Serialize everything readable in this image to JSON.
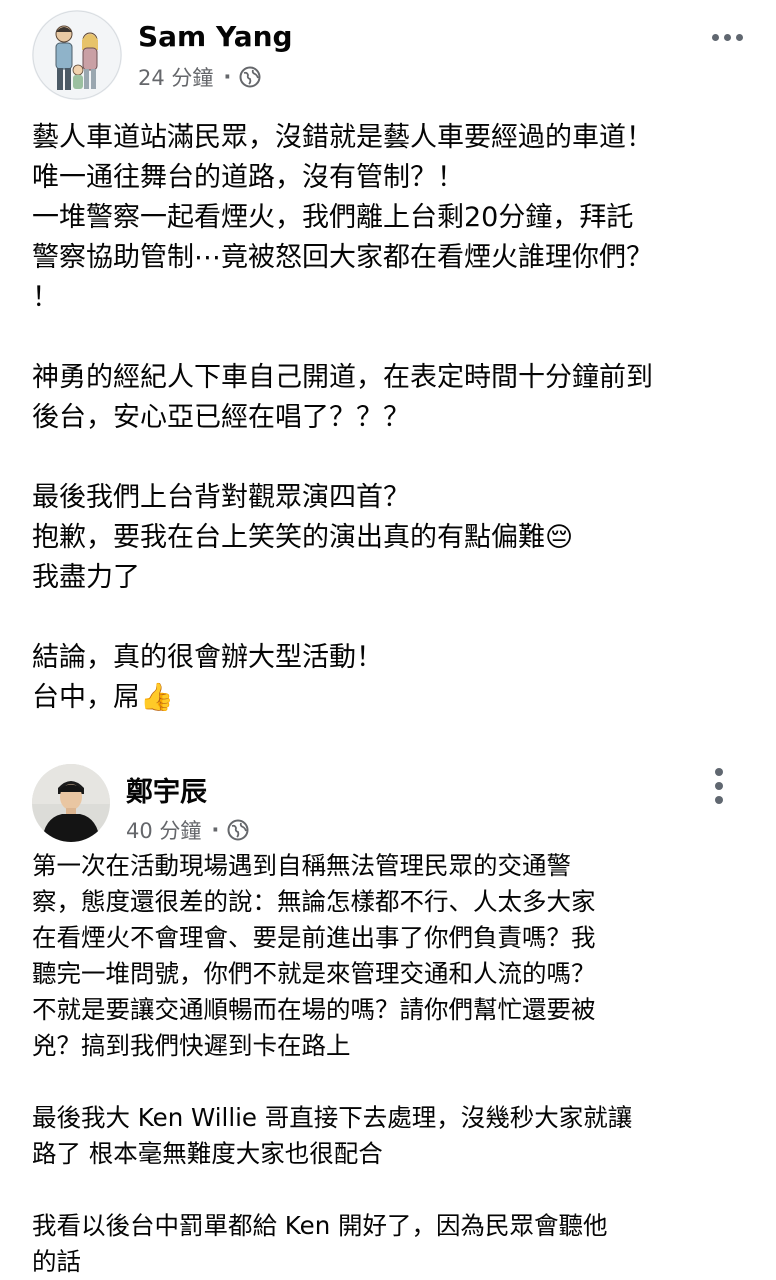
{
  "posts": [
    {
      "author": "Sam Yang",
      "time": "24 分鐘",
      "separator": "·",
      "privacy_icon": "globe-icon",
      "menu_icon": "more-horizontal-icon",
      "lines": [
        "藝人車道站滿民眾，沒錯就是藝人車要經過的車道！",
        "唯一通往舞台的道路，沒有管制？！",
        "一堆警察一起看煙火，我們離上台剩20分鐘，拜託",
        "警察協助管制⋯竟被怒回大家都在看煙火誰理你們？",
        "！",
        "",
        "神勇的經紀人下車自己開道，在表定時間十分鐘前到",
        "後台，安心亞已經在唱了？？？",
        "",
        "最後我們上台背對觀眾演四首？",
        "抱歉，要我在台上笑笑的演出真的有點偏難😔",
        "我盡力了",
        "",
        "結論，真的很會辦大型活動！",
        "台中，屌👍"
      ]
    },
    {
      "author": "鄭宇辰",
      "time": "40 分鐘",
      "separator": "·",
      "privacy_icon": "globe-icon",
      "menu_icon": "more-vertical-icon",
      "lines": [
        "第一次在活動現場遇到自稱無法管理民眾的交通警",
        "察，態度還很差的說：無論怎樣都不行、人太多大家",
        "在看煙火不會理會、要是前進出事了你們負責嗎？我",
        "聽完一堆問號，你們不就是來管理交通和人流的嗎？",
        "不就是要讓交通順暢而在場的嗎？請你們幫忙還要被",
        "兇？搞到我們快遲到卡在路上",
        "",
        "最後我大 Ken Willie 哥直接下去處理，沒幾秒大家就讓",
        "路了 根本毫無難度大家也很配合",
        "",
        "我看以後台中罰單都給 Ken 開好了，因為民眾會聽他",
        "的話"
      ]
    }
  ]
}
